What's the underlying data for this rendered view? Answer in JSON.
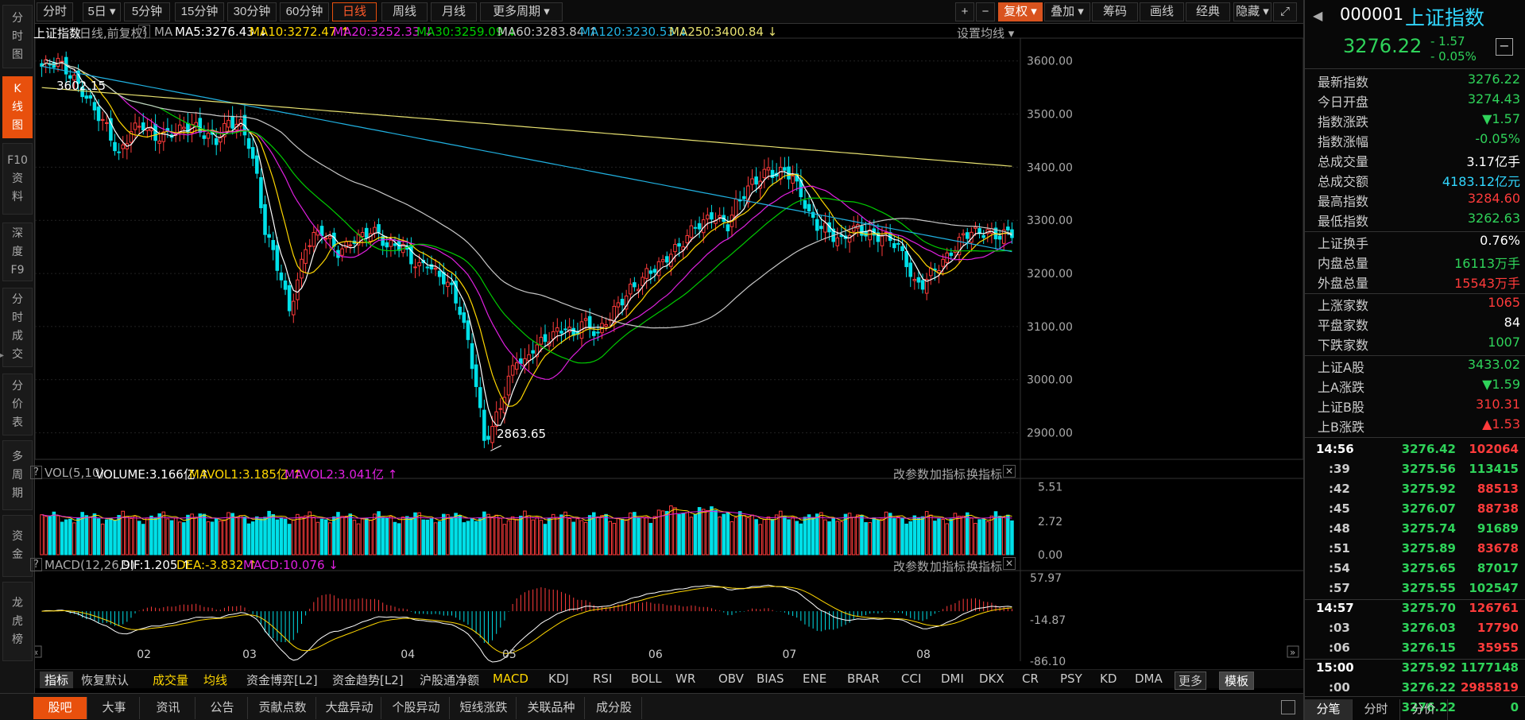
{
  "left_tabs": [
    {
      "label": "分\n时\n图"
    },
    {
      "label": "K\n线\n图"
    },
    {
      "label": "F10\n资\n料"
    },
    {
      "label": "深\n度\nF9"
    },
    {
      "label": "分\n时\n成\n交"
    },
    {
      "label": "分\n价\n表"
    },
    {
      "label": "多\n周\n期"
    },
    {
      "label": "资\n金"
    },
    {
      "label": "龙\n虎\n榜"
    }
  ],
  "toolbar": {
    "periods": [
      "分时",
      "5日 ▾",
      "5分钟",
      "15分钟",
      "30分钟",
      "60分钟",
      "日线",
      "周线",
      "月线",
      "更多周期 ▾"
    ],
    "right_buttons": [
      "+",
      "−",
      "复权 ▾",
      "叠加 ▾",
      "筹码",
      "画线",
      "经典",
      "隐藏 ▾",
      "⤢"
    ]
  },
  "chart_header": {
    "name": "上证指数",
    "mode": "(日线,前复权)",
    "q": "?",
    "ma": "MA",
    "ma5": "MA5:3276.43 ↓",
    "ma10": "MA10:3272.47 ↑",
    "ma20": "MA20:3252.33 ↓",
    "ma30": "MA30:3259.09 ↓",
    "ma60": "MA60:3283.84 ↑",
    "ma120": "MA120:3230.53 ↓",
    "ma250": "MA250:3400.84 ↓",
    "settings": "设置均线 ▾"
  },
  "vol_header": {
    "q": "?",
    "name": "VOL(5,10)",
    "volume": "VOLUME:3.166亿 ↑",
    "mavol1": "MAVOL1:3.185亿 ↑",
    "mavol2": "MAVOL2:3.041亿 ↑",
    "btn1": "改参数",
    "btn2": "加指标",
    "btn3": "换指标",
    "close": "✕"
  },
  "macd_header": {
    "q": "?",
    "name": "MACD(12,26,9)",
    "dif": "DIF:1.205 ↑",
    "dea": "DEA:-3.832 ↑",
    "macd": "MACD:10.076 ↓",
    "btn1": "改参数",
    "btn2": "加指标",
    "btn3": "换指标",
    "close": "✕"
  },
  "annotations": {
    "high": "3602.15",
    "low": "2863.65"
  },
  "month_labels": [
    "02",
    "03",
    "04",
    "05",
    "06",
    "07",
    "08"
  ],
  "indicator_tabs": [
    "指标",
    "恢复默认",
    "成交量",
    "均线",
    "资金博弈[L2]",
    "资金趋势[L2]",
    "沪股通净额",
    "MACD",
    "KDJ",
    "RSI",
    "BOLL",
    "WR",
    "OBV",
    "BIAS",
    "ENE",
    "BRAR",
    "CCI",
    "DMI",
    "DKX",
    "CR",
    "PSY",
    "KD",
    "DMA",
    "更多",
    "模板"
  ],
  "bottom_tabs": [
    "股吧",
    "大事",
    "资讯",
    "公告",
    "贡献点数",
    "大盘异动",
    "个股异动",
    "短线涨跌",
    "关联品种",
    "成分股"
  ],
  "right_panel": {
    "code": "000001",
    "name": "上证指数",
    "price": "3276.22",
    "change": "- 1.57",
    "change_pct": "- 0.05%",
    "minus": "−",
    "stats": [
      {
        "k": "最新指数",
        "v": "3276.22",
        "c": "green"
      },
      {
        "k": "今日开盘",
        "v": "3274.43",
        "c": "green"
      },
      {
        "k": "指数涨跌",
        "v": "▼1.57",
        "c": "green"
      },
      {
        "k": "指数涨幅",
        "v": "-0.05%",
        "c": "green"
      },
      {
        "k": "总成交量",
        "v": "3.17亿手",
        "c": "white"
      },
      {
        "k": "总成交额",
        "v": "4183.12亿元",
        "c": "cyan"
      },
      {
        "k": "最高指数",
        "v": "3284.60",
        "c": "red"
      },
      {
        "k": "最低指数",
        "v": "3262.63",
        "c": "green"
      }
    ],
    "stats2": [
      {
        "k": "上证换手",
        "v": "0.76%",
        "c": "white"
      },
      {
        "k": "内盘总量",
        "v": "16113万手",
        "c": "green"
      },
      {
        "k": "外盘总量",
        "v": "15543万手",
        "c": "red"
      }
    ],
    "stats3": [
      {
        "k": "上涨家数",
        "v": "1065",
        "c": "red"
      },
      {
        "k": "平盘家数",
        "v": "84",
        "c": "white"
      },
      {
        "k": "下跌家数",
        "v": "1007",
        "c": "green"
      }
    ],
    "stats4": [
      {
        "k": "上证A股",
        "v": "3433.02",
        "c": "green"
      },
      {
        "k": "上A涨跌",
        "v": "▼1.59",
        "c": "green"
      },
      {
        "k": "上证B股",
        "v": "310.31",
        "c": "red"
      },
      {
        "k": "上B涨跌",
        "v": "▲1.53",
        "c": "red"
      }
    ],
    "ticks": [
      {
        "t": "14:56",
        "p": "3276.42",
        "q": "102064",
        "c": "red",
        "bold": true
      },
      {
        "t": ":39",
        "p": "3275.56",
        "q": "113415",
        "c": "green"
      },
      {
        "t": ":42",
        "p": "3275.92",
        "q": "88513",
        "c": "red"
      },
      {
        "t": ":45",
        "p": "3276.07",
        "q": "88738",
        "c": "red"
      },
      {
        "t": ":48",
        "p": "3275.74",
        "q": "91689",
        "c": "green"
      },
      {
        "t": ":51",
        "p": "3275.89",
        "q": "83678",
        "c": "red"
      },
      {
        "t": ":54",
        "p": "3275.65",
        "q": "87017",
        "c": "green"
      },
      {
        "t": ":57",
        "p": "3275.55",
        "q": "102547",
        "c": "green"
      },
      {
        "t": "14:57",
        "p": "3275.70",
        "q": "126761",
        "c": "red",
        "bold": true
      },
      {
        "t": ":03",
        "p": "3276.03",
        "q": "17790",
        "c": "red"
      },
      {
        "t": ":06",
        "p": "3276.15",
        "q": "35955",
        "c": "red"
      },
      {
        "t": "15:00",
        "p": "3275.92",
        "q": "1177148",
        "c": "green",
        "bold": true
      },
      {
        "t": ":00",
        "p": "3276.22",
        "q": "2985819",
        "c": "red"
      },
      {
        "t": ":00",
        "p": "3276.22",
        "q": "0",
        "c": "green"
      }
    ],
    "tabs": [
      "分笔",
      "分时",
      "分价"
    ]
  },
  "chart_data": {
    "type": "candlestick",
    "price_axis": {
      "ticks": [
        "3600.00",
        "3500.00",
        "3400.00",
        "3300.00",
        "3200.00",
        "3100.00",
        "3000.00",
        "2900.00"
      ],
      "range": [
        2850,
        3640
      ]
    },
    "vol_axis": {
      "ticks": [
        "5.51",
        "2.72",
        "0.00"
      ],
      "range": [
        0,
        6.2
      ]
    },
    "macd_axis": {
      "ticks": [
        "57.97",
        "-14.87",
        "-86.10"
      ],
      "range": [
        -86.1,
        70
      ]
    },
    "month_labels": [
      "02",
      "03",
      "04",
      "05",
      "06",
      "07",
      "08"
    ],
    "month_index": [
      25,
      51,
      90,
      115,
      151,
      184,
      217
    ],
    "close_keys": [
      [
        0,
        3590
      ],
      [
        4,
        3600
      ],
      [
        8,
        3565
      ],
      [
        12,
        3520
      ],
      [
        16,
        3475
      ],
      [
        19,
        3420
      ],
      [
        22,
        3470
      ],
      [
        25,
        3480
      ],
      [
        28,
        3455
      ],
      [
        31,
        3462
      ],
      [
        34,
        3470
      ],
      [
        37,
        3480
      ],
      [
        40,
        3463
      ],
      [
        43,
        3450
      ],
      [
        46,
        3485
      ],
      [
        49,
        3480
      ],
      [
        51,
        3445
      ],
      [
        53,
        3380
      ],
      [
        55,
        3280
      ],
      [
        57,
        3240
      ],
      [
        59,
        3190
      ],
      [
        61,
        3130
      ],
      [
        63,
        3185
      ],
      [
        65,
        3250
      ],
      [
        67,
        3270
      ],
      [
        69,
        3280
      ],
      [
        71,
        3260
      ],
      [
        73,
        3240
      ],
      [
        75,
        3250
      ],
      [
        77,
        3265
      ],
      [
        79,
        3270
      ],
      [
        81,
        3280
      ],
      [
        83,
        3275
      ],
      [
        85,
        3250
      ],
      [
        87,
        3255
      ],
      [
        89,
        3250
      ],
      [
        91,
        3225
      ],
      [
        93,
        3212
      ],
      [
        95,
        3220
      ],
      [
        97,
        3200
      ],
      [
        99,
        3190
      ],
      [
        101,
        3170
      ],
      [
        103,
        3130
      ],
      [
        105,
        3070
      ],
      [
        107,
        2990
      ],
      [
        109,
        2885
      ],
      [
        111,
        2910
      ],
      [
        113,
        2950
      ],
      [
        115,
        3000
      ],
      [
        117,
        3040
      ],
      [
        119,
        3030
      ],
      [
        121,
        3060
      ],
      [
        123,
        3070
      ],
      [
        125,
        3080
      ],
      [
        127,
        3090
      ],
      [
        129,
        3100
      ],
      [
        131,
        3080
      ],
      [
        133,
        3110
      ],
      [
        135,
        3100
      ],
      [
        137,
        3085
      ],
      [
        139,
        3110
      ],
      [
        141,
        3130
      ],
      [
        143,
        3150
      ],
      [
        145,
        3170
      ],
      [
        147,
        3180
      ],
      [
        149,
        3200
      ],
      [
        151,
        3210
      ],
      [
        153,
        3220
      ],
      [
        155,
        3240
      ],
      [
        157,
        3250
      ],
      [
        159,
        3270
      ],
      [
        161,
        3290
      ],
      [
        163,
        3295
      ],
      [
        165,
        3310
      ],
      [
        167,
        3300
      ],
      [
        169,
        3290
      ],
      [
        171,
        3330
      ],
      [
        173,
        3350
      ],
      [
        175,
        3370
      ],
      [
        177,
        3380
      ],
      [
        179,
        3395
      ],
      [
        181,
        3385
      ],
      [
        183,
        3395
      ],
      [
        185,
        3380
      ],
      [
        187,
        3350
      ],
      [
        189,
        3310
      ],
      [
        191,
        3290
      ],
      [
        193,
        3285
      ],
      [
        195,
        3270
      ],
      [
        197,
        3260
      ],
      [
        199,
        3280
      ],
      [
        201,
        3285
      ],
      [
        203,
        3275
      ],
      [
        205,
        3270
      ],
      [
        207,
        3270
      ],
      [
        209,
        3265
      ],
      [
        211,
        3250
      ],
      [
        213,
        3220
      ],
      [
        215,
        3180
      ],
      [
        217,
        3180
      ],
      [
        219,
        3200
      ],
      [
        221,
        3215
      ],
      [
        223,
        3230
      ],
      [
        225,
        3250
      ],
      [
        227,
        3270
      ],
      [
        229,
        3280
      ],
      [
        231,
        3275
      ],
      [
        233,
        3280
      ],
      [
        235,
        3270
      ],
      [
        237,
        3275
      ],
      [
        239,
        3276
      ]
    ],
    "ma5": "MA5:3276.43 ↓",
    "ma10": "MA10:3272.47 ↑",
    "ma20": "MA20:3252.33 ↓",
    "ma30": "MA30:3259.09 ↓",
    "ma60": "MA60:3283.84 ↑",
    "ma120": "MA120:3230.53 ↓",
    "ma250": "MA250:3400.84 ↓",
    "high_label": "3602.15",
    "low_label": "2863.65",
    "series_colors": {
      "up": "#ff3b3b",
      "down": "#00e0e8",
      "ma5": "#ffffff",
      "ma10": "#ffd700",
      "ma20": "#e020e0",
      "ma30": "#00cc00",
      "ma60": "#c8c8c8",
      "ma120": "#20b0e0",
      "ma250": "#e6e070"
    }
  }
}
